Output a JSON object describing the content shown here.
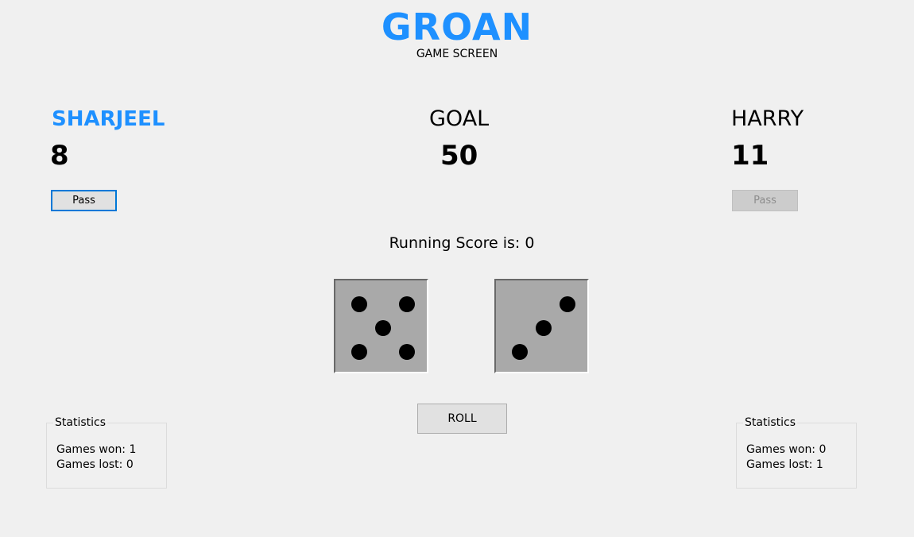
{
  "app": {
    "title": "GROAN",
    "subtitle": "GAME SCREEN"
  },
  "players": [
    {
      "name": "SHARJEEL",
      "score": "8",
      "pass_label": "Pass",
      "pass_enabled": true,
      "active": true,
      "stats": {
        "legend": "Statistics",
        "games_won": "Games won: 1",
        "games_lost": "Games lost: 0"
      }
    },
    {
      "name": "HARRY",
      "score": "11",
      "pass_label": "Pass",
      "pass_enabled": false,
      "active": false,
      "stats": {
        "legend": "Statistics",
        "games_won": "Games won: 0",
        "games_lost": "Games lost: 1"
      }
    }
  ],
  "goal": {
    "label": "GOAL",
    "value": "50"
  },
  "running_score": "Running Score is: 0",
  "dice": [
    {
      "value": 5
    },
    {
      "value": 3
    }
  ],
  "roll_label": "ROLL",
  "colors": {
    "accent": "#1e90ff",
    "background": "#f0f0f0",
    "die_face": "#a9a9a9",
    "pip": "#000000"
  }
}
